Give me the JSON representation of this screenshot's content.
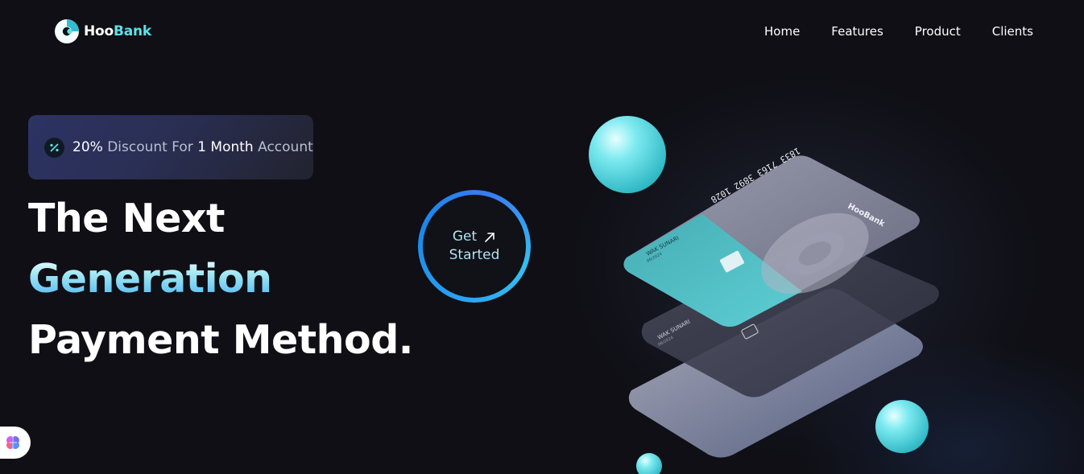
{
  "brand": {
    "name_part1": "Hoo",
    "name_part2": "Bank",
    "logo_icon": "hoobank-logo-icon",
    "accent_color": "#5ce1e6"
  },
  "nav": {
    "items": [
      {
        "label": "Home"
      },
      {
        "label": "Features"
      },
      {
        "label": "Product"
      },
      {
        "label": "Clients"
      }
    ]
  },
  "hero": {
    "badge": {
      "icon": "discount-icon",
      "parts": [
        {
          "text": "20%",
          "emphasis": true
        },
        {
          "text": " Discount For ",
          "emphasis": false
        },
        {
          "text": "1 Month",
          "emphasis": true
        },
        {
          "text": " Account",
          "emphasis": false
        }
      ]
    },
    "headline": {
      "line1": "The Next",
      "line2": "Generation",
      "line3": "Payment Method."
    },
    "cta": {
      "line1": "Get",
      "line2": "Started",
      "icon": "arrow-up-right-icon"
    }
  },
  "illustration": {
    "card_number": "1833 7163 3892 1028",
    "card_brand": "HooBank",
    "cardholder": "WAK SUNARI",
    "expiry": "06/2024"
  },
  "widget": {
    "icon": "brain-icon"
  }
}
